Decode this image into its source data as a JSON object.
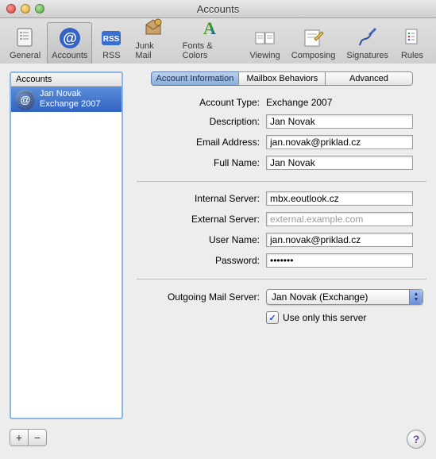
{
  "window": {
    "title": "Accounts"
  },
  "toolbar": {
    "items": [
      {
        "label": "General"
      },
      {
        "label": "Accounts"
      },
      {
        "label": "RSS"
      },
      {
        "label": "Junk Mail"
      },
      {
        "label": "Fonts & Colors"
      },
      {
        "label": "Viewing"
      },
      {
        "label": "Composing"
      },
      {
        "label": "Signatures"
      },
      {
        "label": "Rules"
      }
    ],
    "selected_index": 1
  },
  "sidebar": {
    "header": "Accounts",
    "items": [
      {
        "name": "Jan Novak",
        "subtitle": "Exchange 2007",
        "selected": true
      }
    ],
    "add_label": "+",
    "remove_label": "−"
  },
  "tabs": {
    "items": [
      {
        "label": "Account Information"
      },
      {
        "label": "Mailbox Behaviors"
      },
      {
        "label": "Advanced"
      }
    ],
    "selected_index": 0
  },
  "form": {
    "account_type": {
      "label": "Account Type:",
      "value": "Exchange 2007"
    },
    "description": {
      "label": "Description:",
      "value": "Jan Novak"
    },
    "email": {
      "label": "Email Address:",
      "value": "jan.novak@priklad.cz"
    },
    "full_name": {
      "label": "Full Name:",
      "value": "Jan Novak"
    },
    "internal_srv": {
      "label": "Internal Server:",
      "value": "mbx.eoutlook.cz"
    },
    "external_srv": {
      "label": "External Server:",
      "value": "",
      "placeholder": "external.example.com"
    },
    "user_name": {
      "label": "User Name:",
      "value": "jan.novak@priklad.cz"
    },
    "password": {
      "label": "Password:",
      "value": "•••••••"
    },
    "outgoing": {
      "label": "Outgoing Mail Server:",
      "value": "Jan Novak (Exchange)"
    },
    "use_only": {
      "label": "Use only this server",
      "checked": true
    }
  },
  "help_label": "?"
}
